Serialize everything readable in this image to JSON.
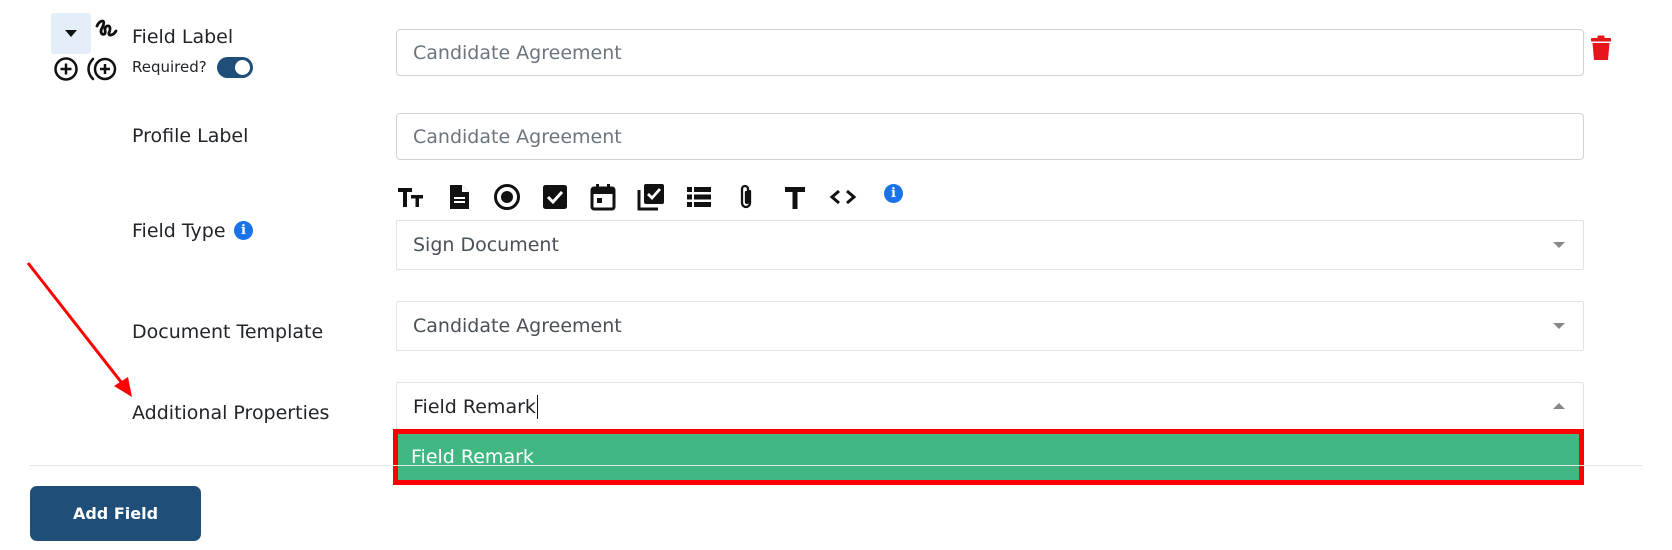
{
  "field_label": {
    "label": "Field Label",
    "value": "Candidate Agreement"
  },
  "required": {
    "label": "Required?",
    "enabled": true
  },
  "profile_label": {
    "label": "Profile Label",
    "value": "Candidate Agreement"
  },
  "field_type": {
    "label": "Field Type",
    "selected": "Sign Document",
    "toolbar_icons": [
      "text-size-icon",
      "document-icon",
      "radio-icon",
      "checkbox-icon",
      "calendar-icon",
      "multi-checkbox-icon",
      "list-icon",
      "attachment-icon",
      "text-icon",
      "code-icon",
      "info-icon"
    ]
  },
  "document_template": {
    "label": "Document Template",
    "selected": "Candidate Agreement"
  },
  "additional_properties": {
    "label": "Additional Properties",
    "search_value": "Field Remark",
    "options": [
      "Field Remark"
    ]
  },
  "actions": {
    "add_field_label": "Add Field"
  },
  "colors": {
    "primary": "#1f4e79",
    "option_highlight": "#41b883",
    "delete": "#e8141c",
    "annotation": "#ff0000",
    "info": "#1a73e8"
  }
}
